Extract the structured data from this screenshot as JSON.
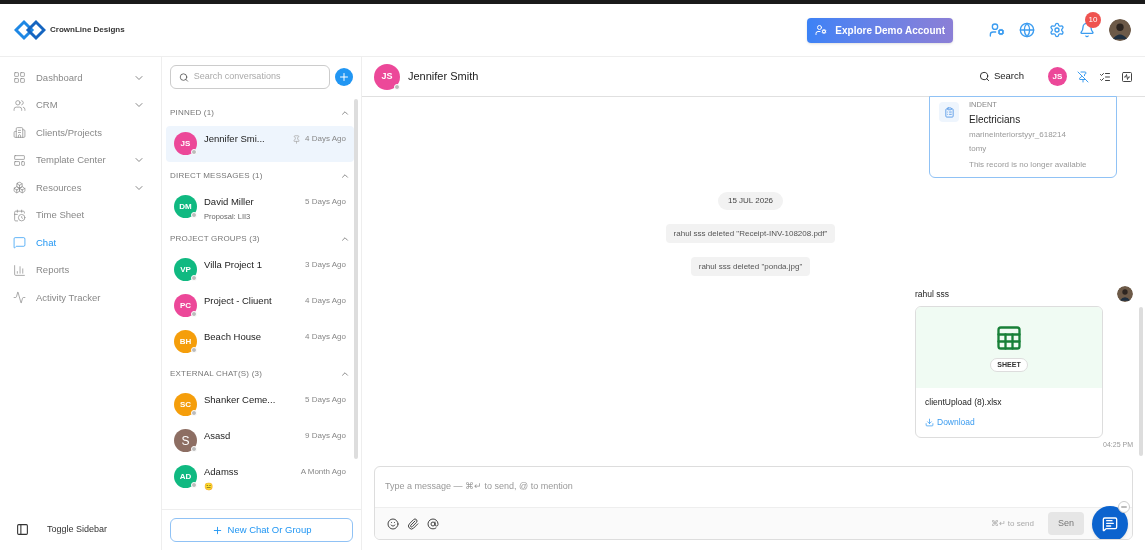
{
  "brand": {
    "name": "CrownLine Designs"
  },
  "topbar": {
    "demo_button": "Explore Demo Account",
    "notification_count": "10"
  },
  "sidebar": {
    "items": [
      {
        "label": "Dashboard",
        "expandable": true,
        "selected": false
      },
      {
        "label": "CRM",
        "expandable": true,
        "selected": false
      },
      {
        "label": "Clients/Projects",
        "expandable": false,
        "selected": false
      },
      {
        "label": "Template Center",
        "expandable": true,
        "selected": false
      },
      {
        "label": "Resources",
        "expandable": true,
        "selected": false
      },
      {
        "label": "Time Sheet",
        "expandable": false,
        "selected": false
      },
      {
        "label": "Chat",
        "expandable": false,
        "selected": true
      },
      {
        "label": "Reports",
        "expandable": false,
        "selected": false
      },
      {
        "label": "Activity Tracker",
        "expandable": false,
        "selected": false
      }
    ],
    "toggle": "Toggle Sidebar"
  },
  "conversations": {
    "search_placeholder": "Search conversations",
    "new_button": "New Chat Or Group",
    "sections": [
      {
        "title": "PINNED (1)",
        "expanded": true,
        "items": [
          {
            "initials": "JS",
            "name": "Jennifer Smi...",
            "time": "4 Days Ago",
            "color": "#ec4899",
            "pinned": true,
            "selected": true
          }
        ]
      },
      {
        "title": "DIRECT MESSAGES (1)",
        "expanded": true,
        "items": [
          {
            "initials": "DM",
            "name": "David Miller",
            "time": "5 Days Ago",
            "subtitle": "Proposal: LII3",
            "color": "#10b981",
            "pinned": false,
            "selected": false
          }
        ]
      },
      {
        "title": "PROJECT GROUPS (3)",
        "expanded": true,
        "items": [
          {
            "initials": "VP",
            "name": "Villa Project 1",
            "time": "3 Days Ago",
            "color": "#10b981",
            "pinned": false,
            "selected": false
          },
          {
            "initials": "PC",
            "name": "Project - Cliuent",
            "time": "4 Days Ago",
            "color": "#ec4899",
            "pinned": false,
            "selected": false
          },
          {
            "initials": "BH",
            "name": "Beach House",
            "time": "4 Days Ago",
            "color": "#f59e0b",
            "pinned": false,
            "selected": false
          }
        ]
      },
      {
        "title": "EXTERNAL CHAT(S) (3)",
        "expanded": true,
        "items": [
          {
            "initials": "SC",
            "name": "Shanker Ceme...",
            "time": "5 Days Ago",
            "color": "#f59e0b",
            "pinned": false,
            "selected": false
          },
          {
            "initials": "S",
            "name": "Asasd",
            "time": "9 Days Ago",
            "color": "#8d6e63",
            "pinned": false,
            "selected": false
          },
          {
            "initials": "AD",
            "name": "Adamss",
            "time": "A Month Ago",
            "subtitle": "😑",
            "color": "#10b981",
            "pinned": false,
            "selected": false
          }
        ]
      }
    ]
  },
  "chat": {
    "contact_initials": "JS",
    "contact_name": "Jennifer Smith",
    "search_label": "Search",
    "header_badge": "JS",
    "record_card": {
      "type": "INDENT",
      "title": "Electricians",
      "ref": "marineinteriorstyyr_618214",
      "user": "tomy",
      "note": "This record is no longer available"
    },
    "date_chip": "15 JUL 2026",
    "system_messages": [
      "rahul sss deleted \"Receipt-INV-108208.pdf\"",
      "rahul sss deleted \"ponda.jpg\""
    ],
    "file_message": {
      "sender": "rahul sss",
      "badge": "SHEET",
      "file_name": "clientUpload (8).xlsx",
      "action": "Download",
      "time": "04:25 PM"
    },
    "composer": {
      "placeholder": "Type a message — ⌘↵ to send, @ to mention",
      "hint": "⌘↵ to send",
      "send": "Sen"
    }
  }
}
